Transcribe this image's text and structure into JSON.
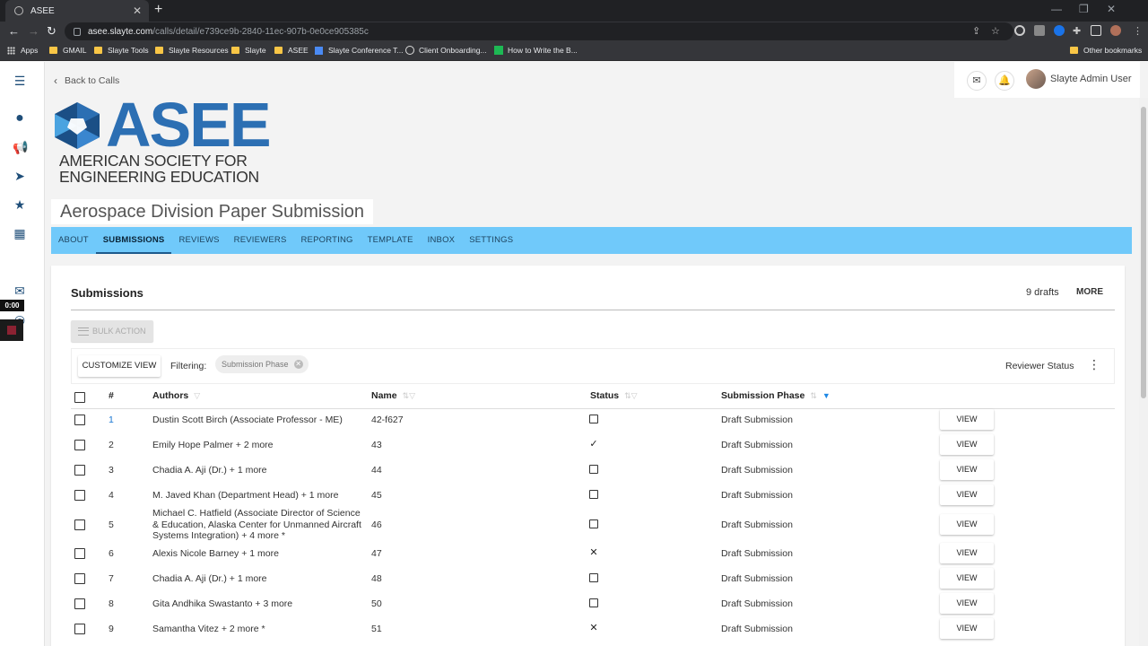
{
  "browser": {
    "tab_title": "ASEE",
    "url_host": "asee.slayte.com",
    "url_path": "/calls/detail/e739ce9b-2840-11ec-907b-0e0ce905385c",
    "bookmarks": [
      "Apps",
      "GMAIL",
      "Slayte Tools",
      "Slayte Resources",
      "Slayte",
      "ASEE",
      "Slayte Conference T...",
      "Client Onboarding...",
      "How to Write the B...",
      "Other bookmarks"
    ]
  },
  "recorder": {
    "timer": "0:00"
  },
  "header": {
    "back_label": "Back to Calls",
    "user_name": "Slayte Admin User"
  },
  "logo": {
    "acronym": "ASEE",
    "line1": "AMERICAN SOCIETY FOR",
    "line2": "ENGINEERING EDUCATION",
    "colors": {
      "blue": "#2c6fb3",
      "dark": "#1b4f86"
    }
  },
  "call_title": "Aerospace Division Paper Submission",
  "tabs": [
    {
      "label": "ABOUT",
      "active": false
    },
    {
      "label": "SUBMISSIONS",
      "active": true
    },
    {
      "label": "REVIEWS",
      "active": false
    },
    {
      "label": "REVIEWERS",
      "active": false
    },
    {
      "label": "REPORTING",
      "active": false
    },
    {
      "label": "TEMPLATE",
      "active": false
    },
    {
      "label": "INBOX",
      "active": false
    },
    {
      "label": "SETTINGS",
      "active": false
    }
  ],
  "submissions": {
    "title": "Submissions",
    "drafts": "9 drafts",
    "more_label": "MORE",
    "bulk_action_label": "BULK ACTION",
    "customize_label": "CUSTOMIZE VIEW",
    "filtering_label": "Filtering:",
    "filter_chip": "Submission Phase",
    "reviewer_status_label": "Reviewer Status",
    "columns": {
      "index": "#",
      "authors": "Authors",
      "name": "Name",
      "status": "Status",
      "phase": "Submission Phase"
    },
    "view_label": "VIEW",
    "rows": [
      {
        "index": "1",
        "authors": "Dustin Scott Birch (Associate Professor - ME)",
        "name": "42-f627",
        "status": "empty",
        "phase": "Draft Submission"
      },
      {
        "index": "2",
        "authors": "Emily Hope Palmer + 2 more",
        "name": "43",
        "status": "check",
        "phase": "Draft Submission"
      },
      {
        "index": "3",
        "authors": "Chadia A. Aji (Dr.) + 1 more",
        "name": "44",
        "status": "empty",
        "phase": "Draft Submission"
      },
      {
        "index": "4",
        "authors": "M. Javed Khan (Department Head) + 1 more",
        "name": "45",
        "status": "empty",
        "phase": "Draft Submission"
      },
      {
        "index": "5",
        "authors": "Michael C. Hatfield (Associate Director of Science & Education, Alaska Center for Unmanned Aircraft Systems Integration) + 4 more *",
        "name": "46",
        "status": "empty",
        "phase": "Draft Submission"
      },
      {
        "index": "6",
        "authors": "Alexis Nicole Barney + 1 more",
        "name": "47",
        "status": "cross",
        "phase": "Draft Submission"
      },
      {
        "index": "7",
        "authors": "Chadia A. Aji (Dr.) + 1 more",
        "name": "48",
        "status": "empty",
        "phase": "Draft Submission"
      },
      {
        "index": "8",
        "authors": "Gita Andhika Swastanto + 3 more",
        "name": "50",
        "status": "empty",
        "phase": "Draft Submission"
      },
      {
        "index": "9",
        "authors": "Samantha Vitez + 2 more *",
        "name": "51",
        "status": "cross",
        "phase": "Draft Submission"
      }
    ]
  }
}
